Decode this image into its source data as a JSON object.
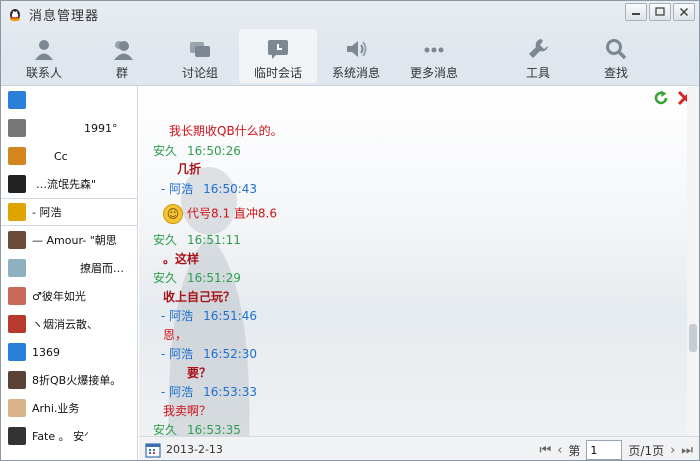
{
  "window": {
    "title": "消息管理器"
  },
  "toolbar": [
    {
      "label": "联系人",
      "icon": "contact-icon"
    },
    {
      "label": "群",
      "icon": "group-icon"
    },
    {
      "label": "讨论组",
      "icon": "discussion-icon"
    },
    {
      "label": "临时会话",
      "icon": "temp-chat-icon",
      "active": true
    },
    {
      "label": "系统消息",
      "icon": "speaker-icon"
    },
    {
      "label": "更多消息",
      "icon": "more-icon"
    },
    {
      "label": "工具",
      "icon": "wrench-icon"
    },
    {
      "label": "查找",
      "icon": "search-icon"
    }
  ],
  "contacts": [
    {
      "name": "",
      "avatar": "#2a7fd9"
    },
    {
      "name": "1991°",
      "avatar": "#777777"
    },
    {
      "name": "Cc",
      "avatar": "#d3861e"
    },
    {
      "name": "…流氓先森\"",
      "avatar": "#222222"
    },
    {
      "name": "- 阿浩",
      "avatar": "#e0a400",
      "selected": true
    },
    {
      "name": "— Amour- \"朝思",
      "avatar": "#6b4b3a"
    },
    {
      "name": "撩眉而…",
      "avatar": "#8fb0bf"
    },
    {
      "name": "♂彼年如光",
      "avatar": "#c76a5a"
    },
    {
      "name": "ヽ烟消云散、",
      "avatar": "#b83a2c"
    },
    {
      "name": "1369",
      "avatar": "#2a7fd9"
    },
    {
      "name": "8折QB火爆接单。",
      "avatar": "#5a4236"
    },
    {
      "name": "Arhi.业务",
      "avatar": "#d9b38a"
    },
    {
      "name": "Fate 。   安ᐟ",
      "avatar": "#333333"
    }
  ],
  "messages": [
    {
      "sender": "",
      "time": "",
      "text": "我长期收QB什么的。",
      "style": "red"
    },
    {
      "sender": "安久",
      "time": "16:50:26",
      "me": false
    },
    {
      "sender": "",
      "time": "",
      "text": "几折",
      "style": "dark"
    },
    {
      "sender": "- 阿浩",
      "time": "16:50:43",
      "me": true
    },
    {
      "sender": "",
      "time": "",
      "text": "代号8.1    直冲8.6",
      "style": "red",
      "emoji": true
    },
    {
      "sender": "安久",
      "time": "16:51:11",
      "me": false
    },
    {
      "sender": "",
      "time": "",
      "text": "。这样",
      "style": "dark"
    },
    {
      "sender": "安久",
      "time": "16:51:29",
      "me": false
    },
    {
      "sender": "",
      "time": "",
      "text": "收上自己玩？",
      "style": "dark"
    },
    {
      "sender": "- 阿浩",
      "time": "16:51:46",
      "me": true
    },
    {
      "sender": "",
      "time": "",
      "text": "恩，",
      "style": "red"
    },
    {
      "sender": "- 阿浩",
      "time": "16:52:30",
      "me": true
    },
    {
      "sender": "",
      "time": "",
      "text": "要？",
      "style": "dark"
    },
    {
      "sender": "- 阿浩",
      "time": "16:53:33",
      "me": true
    },
    {
      "sender": "",
      "time": "",
      "text": "我卖啊？",
      "style": "red"
    },
    {
      "sender": "安久",
      "time": "16:53:35",
      "me": false
    }
  ],
  "footer": {
    "date": "2013-2-13",
    "page_prefix": "第",
    "page_value": "1",
    "page_suffix": "页/1页"
  },
  "colors": {
    "sender_other": "#2f9e4f",
    "sender_me": "#1e6fd0",
    "text_red": "#d1121a",
    "text_dark": "#a8131a"
  }
}
